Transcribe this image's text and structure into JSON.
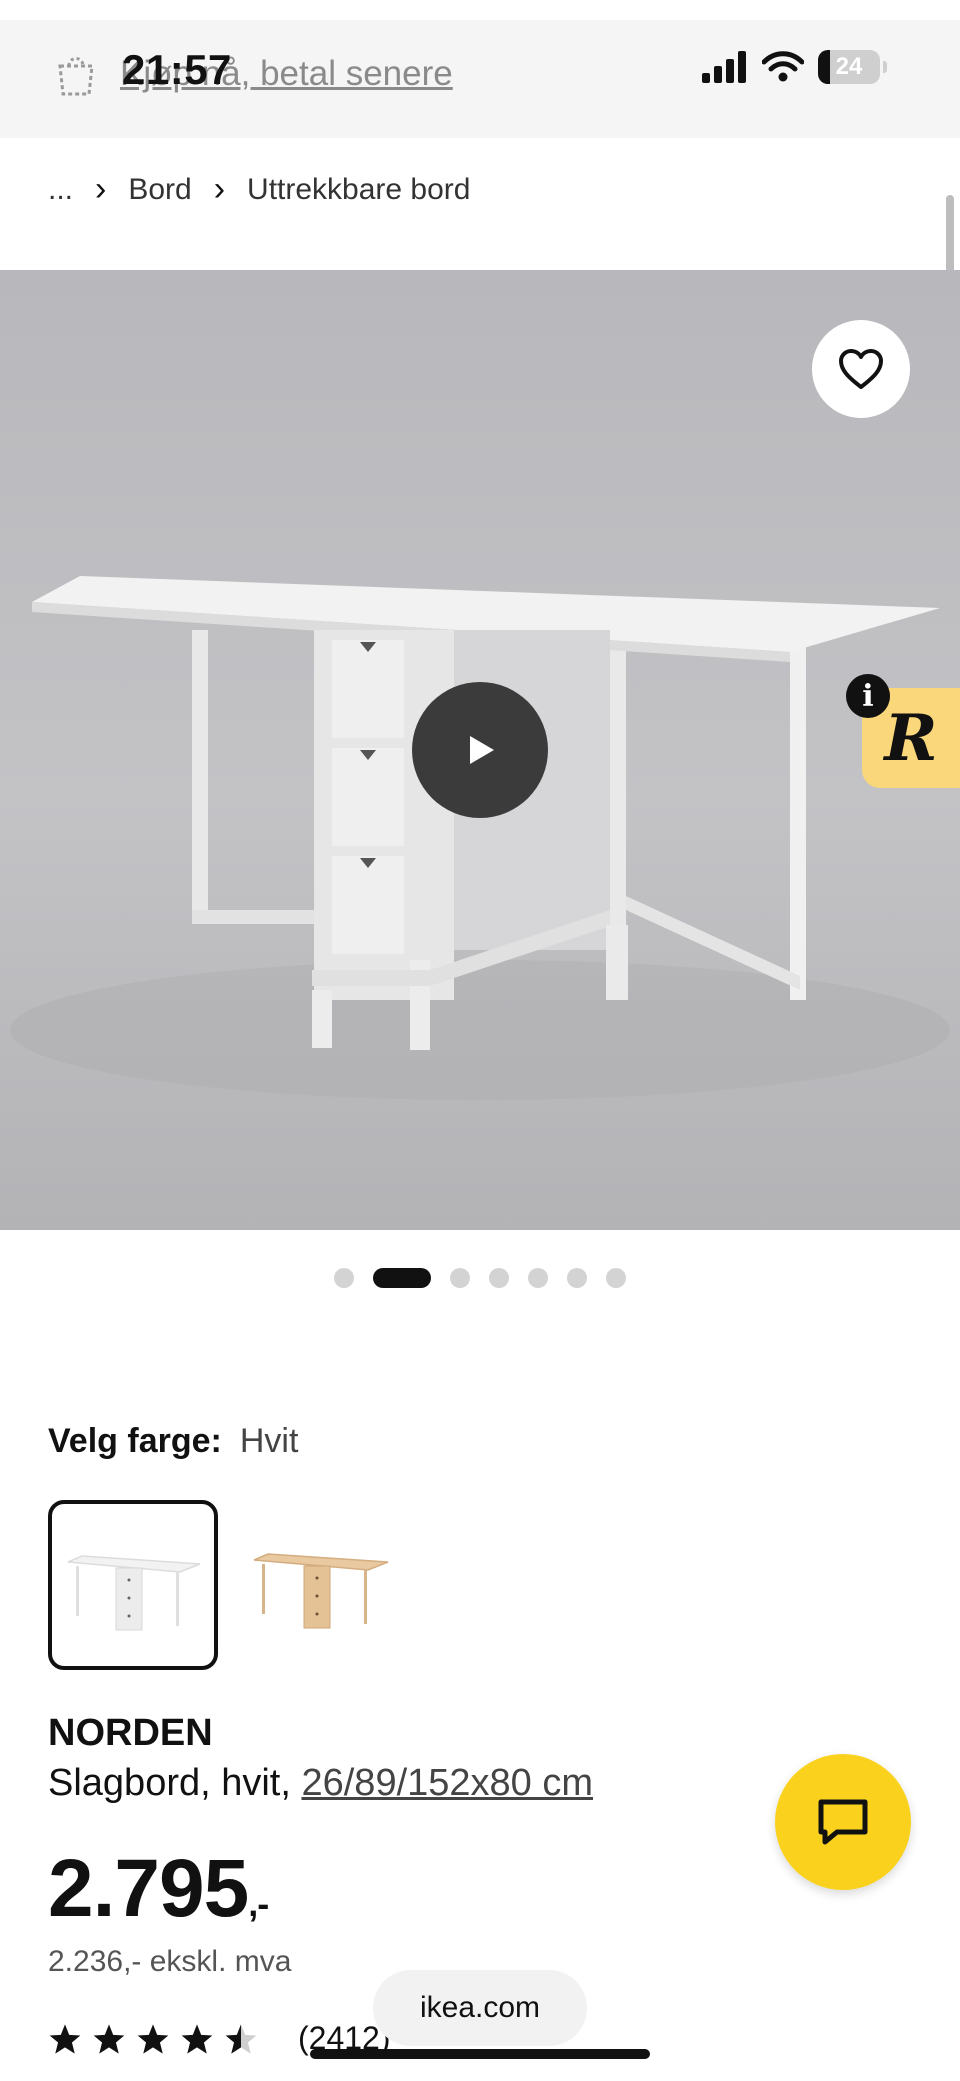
{
  "status_bar": {
    "time": "21:57",
    "battery": "24"
  },
  "promo": {
    "text": "Kjøp nå, betal senere"
  },
  "breadcrumb": {
    "ellipsis": "...",
    "items": [
      "Bord",
      "Uttrekkbare bord"
    ]
  },
  "gallery": {
    "dot_count": 7,
    "active_index": 1
  },
  "badge": {
    "letter": "R",
    "info": "i"
  },
  "color_select": {
    "label": "Velg farge:",
    "value": "Hvit"
  },
  "product": {
    "name": "NORDEN",
    "desc_prefix": "Slagbord, hvit, ",
    "dimensions": "26/89/152x80 cm",
    "price_main": "2.795",
    "price_suffix": ",-",
    "price_excl": "2.236,- ekskl. mva",
    "rating": 4.5,
    "rating_count": "(2412)"
  },
  "browser": {
    "url": "ikea.com"
  },
  "colors": {
    "accent": "#fad21e",
    "badge": "#fbd77b"
  }
}
